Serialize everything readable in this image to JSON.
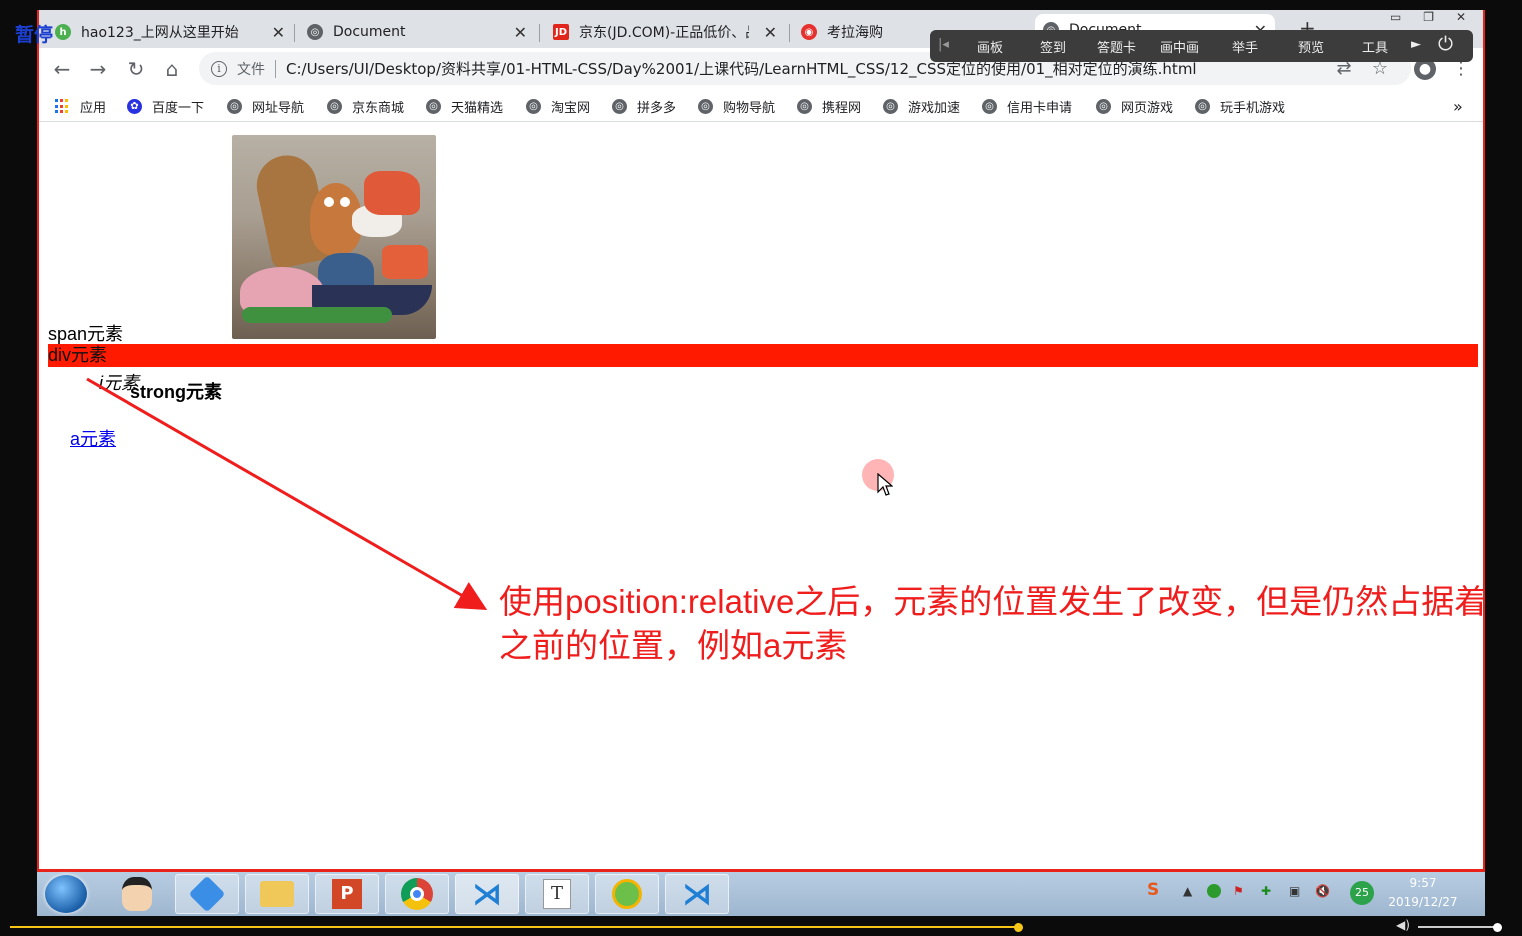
{
  "recorder": {
    "pause_label": "暂停",
    "menu": [
      "画板",
      "签到",
      "答题卡",
      "画中画",
      "举手",
      "预览",
      "工具"
    ]
  },
  "tabs": [
    {
      "label": "hao123_上网从这里开始"
    },
    {
      "label": "Document"
    },
    {
      "label": "京东(JD.COM)-正品低价、品"
    },
    {
      "label": "考拉海购"
    },
    {
      "label": "Document"
    }
  ],
  "address": {
    "scheme_label": "文件",
    "url": "C:/Users/UI/Desktop/资料共享/01-HTML-CSS/Day%2001/上课代码/LearnHTML_CSS/12_CSS定位的使用/01_相对定位的演练.html"
  },
  "bookmarks": [
    "应用",
    "百度一下",
    "网址导航",
    "京东商城",
    "天猫精选",
    "淘宝网",
    "拼多多",
    "购物导航",
    "携程网",
    "游戏加速",
    "信用卡申请",
    "网页游戏",
    "玩手机游戏"
  ],
  "page": {
    "span_text": "span元素",
    "div_text": "div元素",
    "i_text": "i元素",
    "strong_text": "strong元素",
    "a_text": "a元素",
    "annotation_line1": "使用position:relative之后，元素的位置发生了改变，但是仍然占据着",
    "annotation_line2": "之前的位置，例如a元素"
  },
  "taskbar": {
    "time": "9:57",
    "date": "2019/12/27",
    "badge": "25"
  },
  "colors": {
    "div_background": "#ff1a00",
    "annotation": "#f01d1d",
    "window_border": "#e8231a"
  }
}
